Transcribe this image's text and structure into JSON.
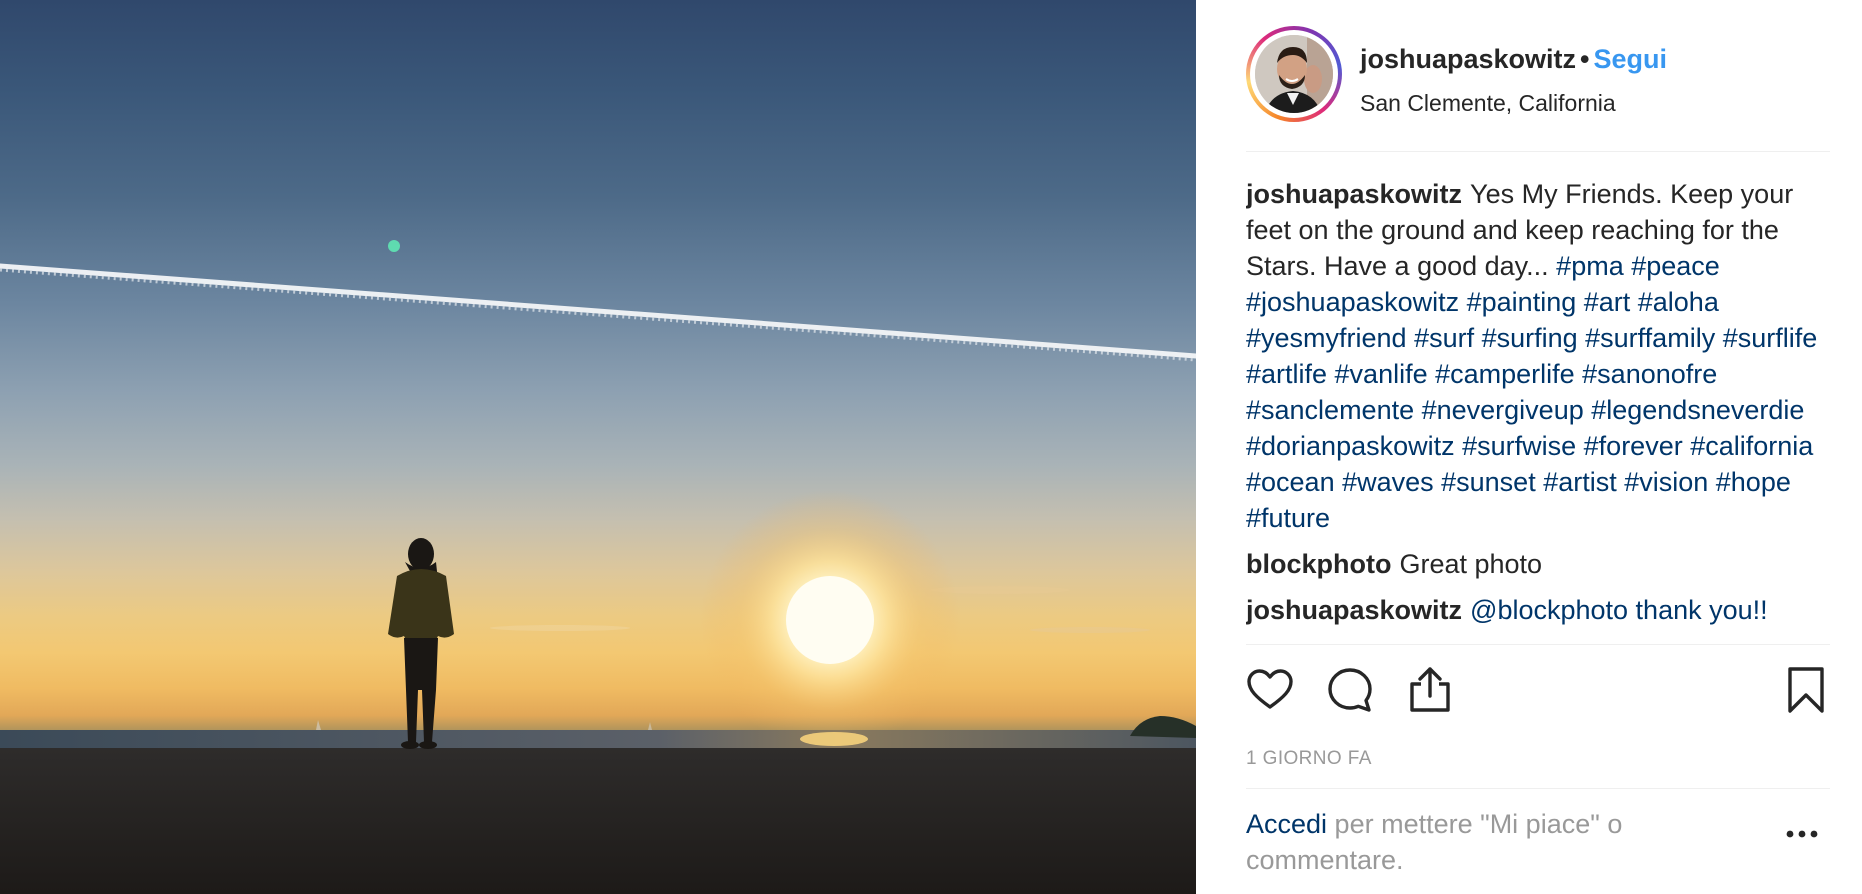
{
  "post": {
    "username": "joshuapaskowitz",
    "separator": "•",
    "follow_label": "Segui",
    "location": "San Clemente, California",
    "caption_text": "Yes My Friends. Keep your feet on the ground and keep reaching for the Stars. Have a good day... ",
    "hashtags": "#pma #peace #joshuapaskowitz #painting #art #aloha #yesmyfriend #surf #surfing #surffamily #surflife #artlife #vanlife #camperlife #sanonofre #sanclemente #nevergiveup #legendsneverdie #dorianpaskowitz #surfwise #forever #california #ocean #waves #sunset #artist #vision #hope #future",
    "comments": [
      {
        "author": "blockphoto",
        "text": "Great photo"
      },
      {
        "author": "joshuapaskowitz",
        "text": "@blockphoto thank you!!"
      }
    ],
    "time_label": "1 GIORNO FA",
    "login_link": "Accedi",
    "login_rest": " per mettere \"Mi piace\" o commentare."
  },
  "icons": {
    "like": "heart-outline-icon",
    "comment": "speech-bubble-icon",
    "share": "share-upload-icon",
    "save": "bookmark-icon",
    "more": "ellipsis-icon"
  },
  "colors": {
    "link_blue": "#3897f0",
    "hashtag_navy": "#003569",
    "muted_gray": "#999999",
    "text": "#262626"
  }
}
